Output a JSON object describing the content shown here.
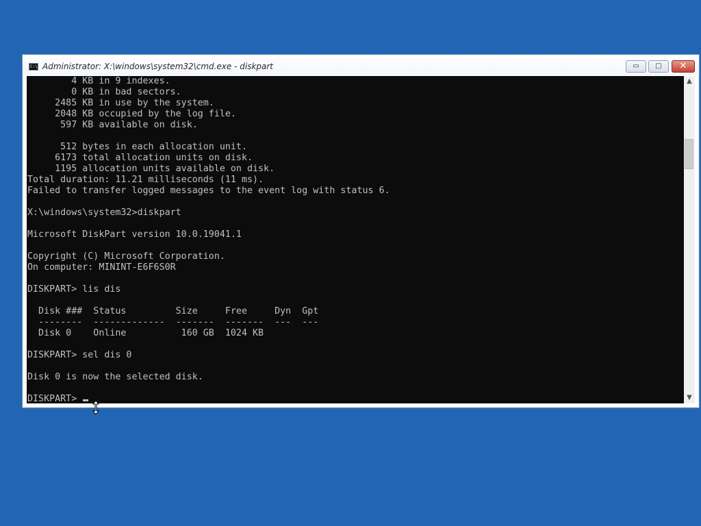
{
  "window": {
    "title": "Administrator: X:\\windows\\system32\\cmd.exe - diskpart",
    "icon": "console-icon",
    "icon_text": "C:\\",
    "minimize_glyph": "▭",
    "maximize_glyph": "□",
    "close_glyph": "✕"
  },
  "console": {
    "lines": [
      "        4 KB in 9 indexes.",
      "        0 KB in bad sectors.",
      "     2485 KB in use by the system.",
      "     2048 KB occupied by the log file.",
      "      597 KB available on disk.",
      "",
      "      512 bytes in each allocation unit.",
      "     6173 total allocation units on disk.",
      "     1195 allocation units available on disk.",
      "Total duration: 11.21 milliseconds (11 ms).",
      "Failed to transfer logged messages to the event log with status 6.",
      "",
      "X:\\windows\\system32>diskpart",
      "",
      "Microsoft DiskPart version 10.0.19041.1",
      "",
      "Copyright (C) Microsoft Corporation.",
      "On computer: MININT-E6F6S0R",
      "",
      "DISKPART> lis dis",
      "",
      "  Disk ###  Status         Size     Free     Dyn  Gpt",
      "  --------  -------------  -------  -------  ---  ---",
      "  Disk 0    Online          160 GB  1024 KB",
      "",
      "DISKPART> sel dis 0",
      "",
      "Disk 0 is now the selected disk.",
      ""
    ],
    "prompt": "DISKPART> "
  },
  "scrollbar": {
    "up_glyph": "▲",
    "down_glyph": "▼"
  },
  "colors": {
    "desktop": "#2265b3",
    "console_bg": "#0c0c0c",
    "console_text": "#c0c0c0",
    "close_button": "#c7422f"
  }
}
